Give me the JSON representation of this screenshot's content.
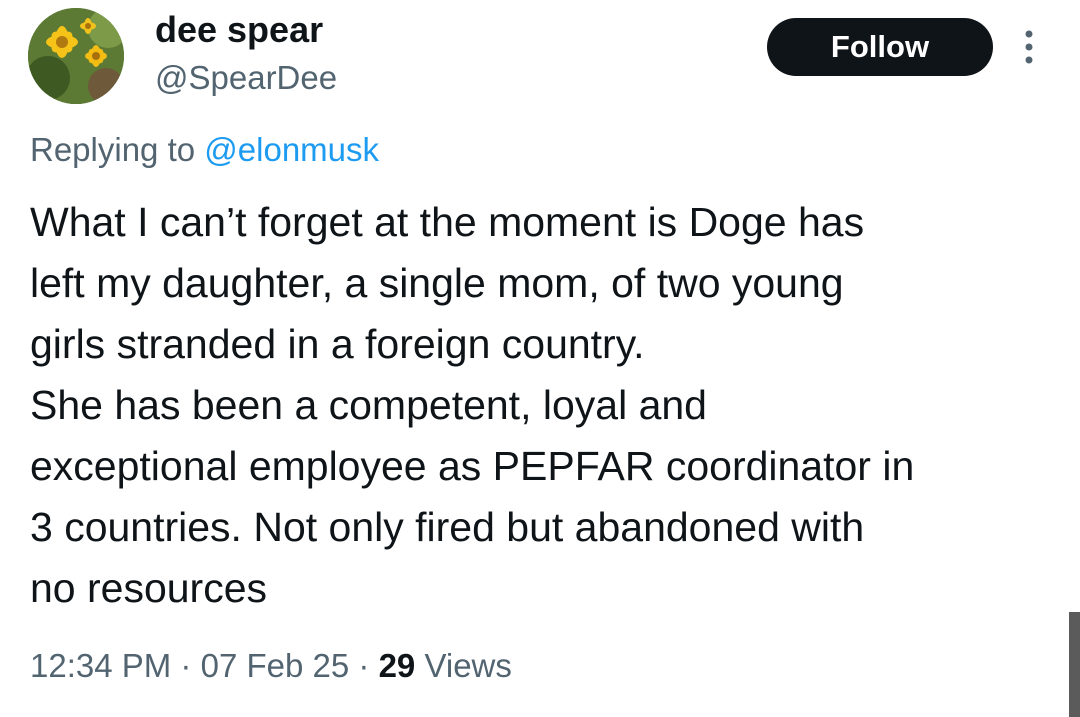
{
  "author": {
    "display_name": "dee spear",
    "handle": "@SpearDee",
    "avatar_icon": "flower-avatar"
  },
  "actions": {
    "follow_label": "Follow",
    "more_icon": "more-vertical-icon"
  },
  "reply": {
    "prefix": "Replying to",
    "handle": "@elonmusk"
  },
  "tweet": {
    "lines": [
      "What I can’t forget at the moment is Doge has",
      "left my daughter, a single mom, of two young",
      "girls stranded in a foreign country.",
      "She has been a competent, loyal and",
      "exceptional employee as PEPFAR coordinator in",
      "3 countries. Not only fired but abandoned with",
      "no resources"
    ]
  },
  "meta": {
    "time": "12:34 PM",
    "separator": "·",
    "date": "07 Feb 25",
    "views_count": "29",
    "views_label": "Views"
  },
  "colors": {
    "link": "#1d9bf0",
    "secondary_text": "#536471",
    "primary_text": "#0f1419",
    "button_bg": "#0f1419"
  }
}
